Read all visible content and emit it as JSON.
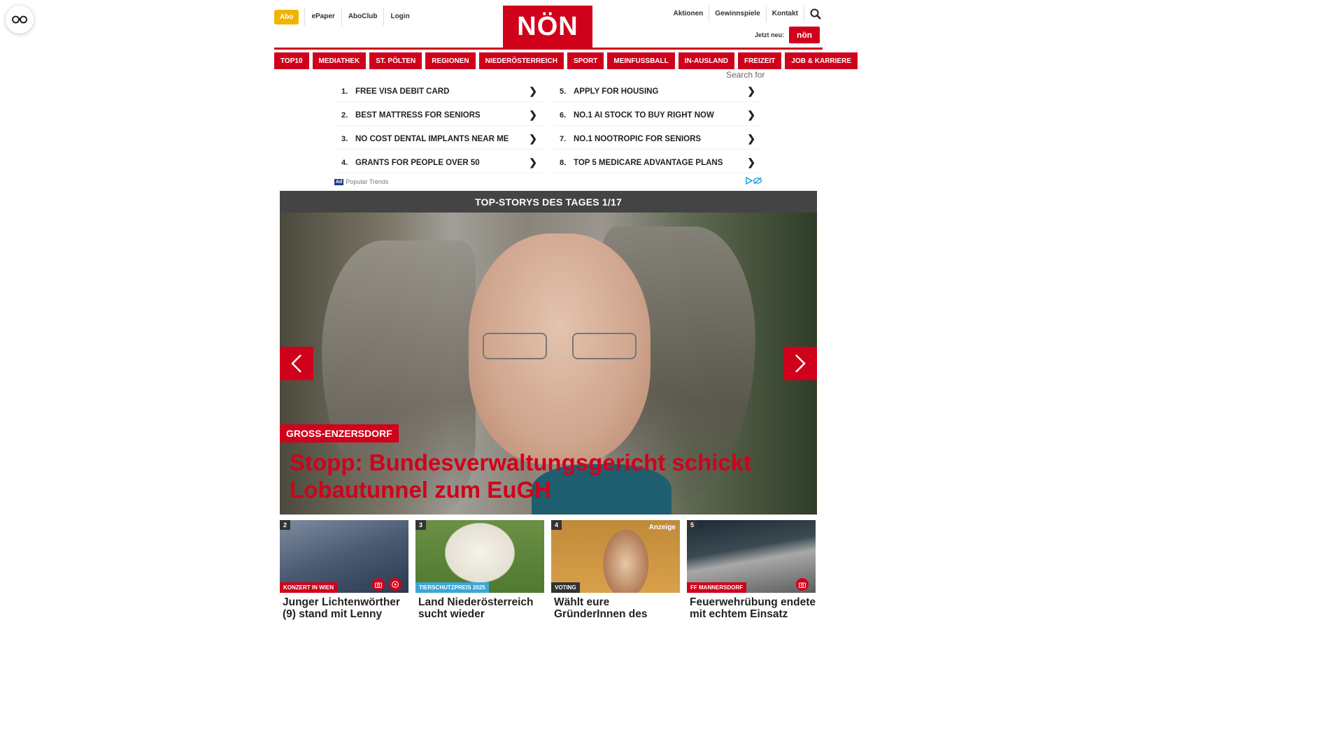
{
  "header": {
    "abo": "Abo",
    "util_left": [
      "ePaper",
      "AboClub",
      "Login"
    ],
    "logo": "NÖN",
    "util_right": [
      "Aktionen",
      "Gewinnspiele",
      "Kontakt"
    ],
    "jetzt_neu": "Jetzt neu:",
    "jetzt_badge": "nön"
  },
  "nav": [
    "TOP10",
    "MEDIATHEK",
    "ST. PÖLTEN",
    "REGIONEN",
    "NIEDERÖSTERREICH",
    "SPORT",
    "MEINFUSSBALL",
    "IN-AUSLAND",
    "FREIZEIT",
    "JOB & KARRIERE"
  ],
  "search_for": "Search for",
  "ad": {
    "items": [
      {
        "num": "1.",
        "text": "FREE VISA DEBIT CARD"
      },
      {
        "num": "5.",
        "text": "APPLY FOR HOUSING"
      },
      {
        "num": "2.",
        "text": "BEST MATTRESS FOR SENIORS"
      },
      {
        "num": "6.",
        "text": "NO.1 AI STOCK TO BUY RIGHT NOW"
      },
      {
        "num": "3.",
        "text": "NO COST DENTAL IMPLANTS NEAR ME"
      },
      {
        "num": "7.",
        "text": "NO.1 NOOTROPIC FOR SENIORS"
      },
      {
        "num": "4.",
        "text": "GRANTS FOR PEOPLE OVER 50"
      },
      {
        "num": "8.",
        "text": "TOP 5 MEDICARE ADVANTAGE PLANS"
      }
    ],
    "chevron": "❯",
    "tag": "Ad",
    "label": "Popular Trends"
  },
  "slider": {
    "title": "TOP-STORYS DES TAGES 1/17",
    "kicker": "GROSS-ENZERSDORF",
    "headline": "Stopp: Bundesverwaltungsgericht schickt Lobautunnel zum EuGH"
  },
  "cards": [
    {
      "num": "2",
      "cat": "KONZERT IN WIEN",
      "cat_color": "#d0021b",
      "title": "Junger Lichtenwörther (9) stand mit Lenny"
    },
    {
      "num": "3",
      "cat": "TIERSCHUTZPREIS 2025",
      "cat_color": "#3aa6d8",
      "title": "Land Niederösterreich sucht wieder"
    },
    {
      "num": "4",
      "cat": "VOTING",
      "cat_color": "#333333",
      "anzeige": "Anzeige",
      "title": "Wählt eure GründerInnen des"
    },
    {
      "num": "5",
      "cat": "FF MANNERSDORF",
      "cat_color": "#d0021b",
      "title": "Feuerwehrübung endete mit echtem Einsatz"
    }
  ],
  "colors": {
    "brand": "#d0021b",
    "abo": "#f0b400"
  }
}
